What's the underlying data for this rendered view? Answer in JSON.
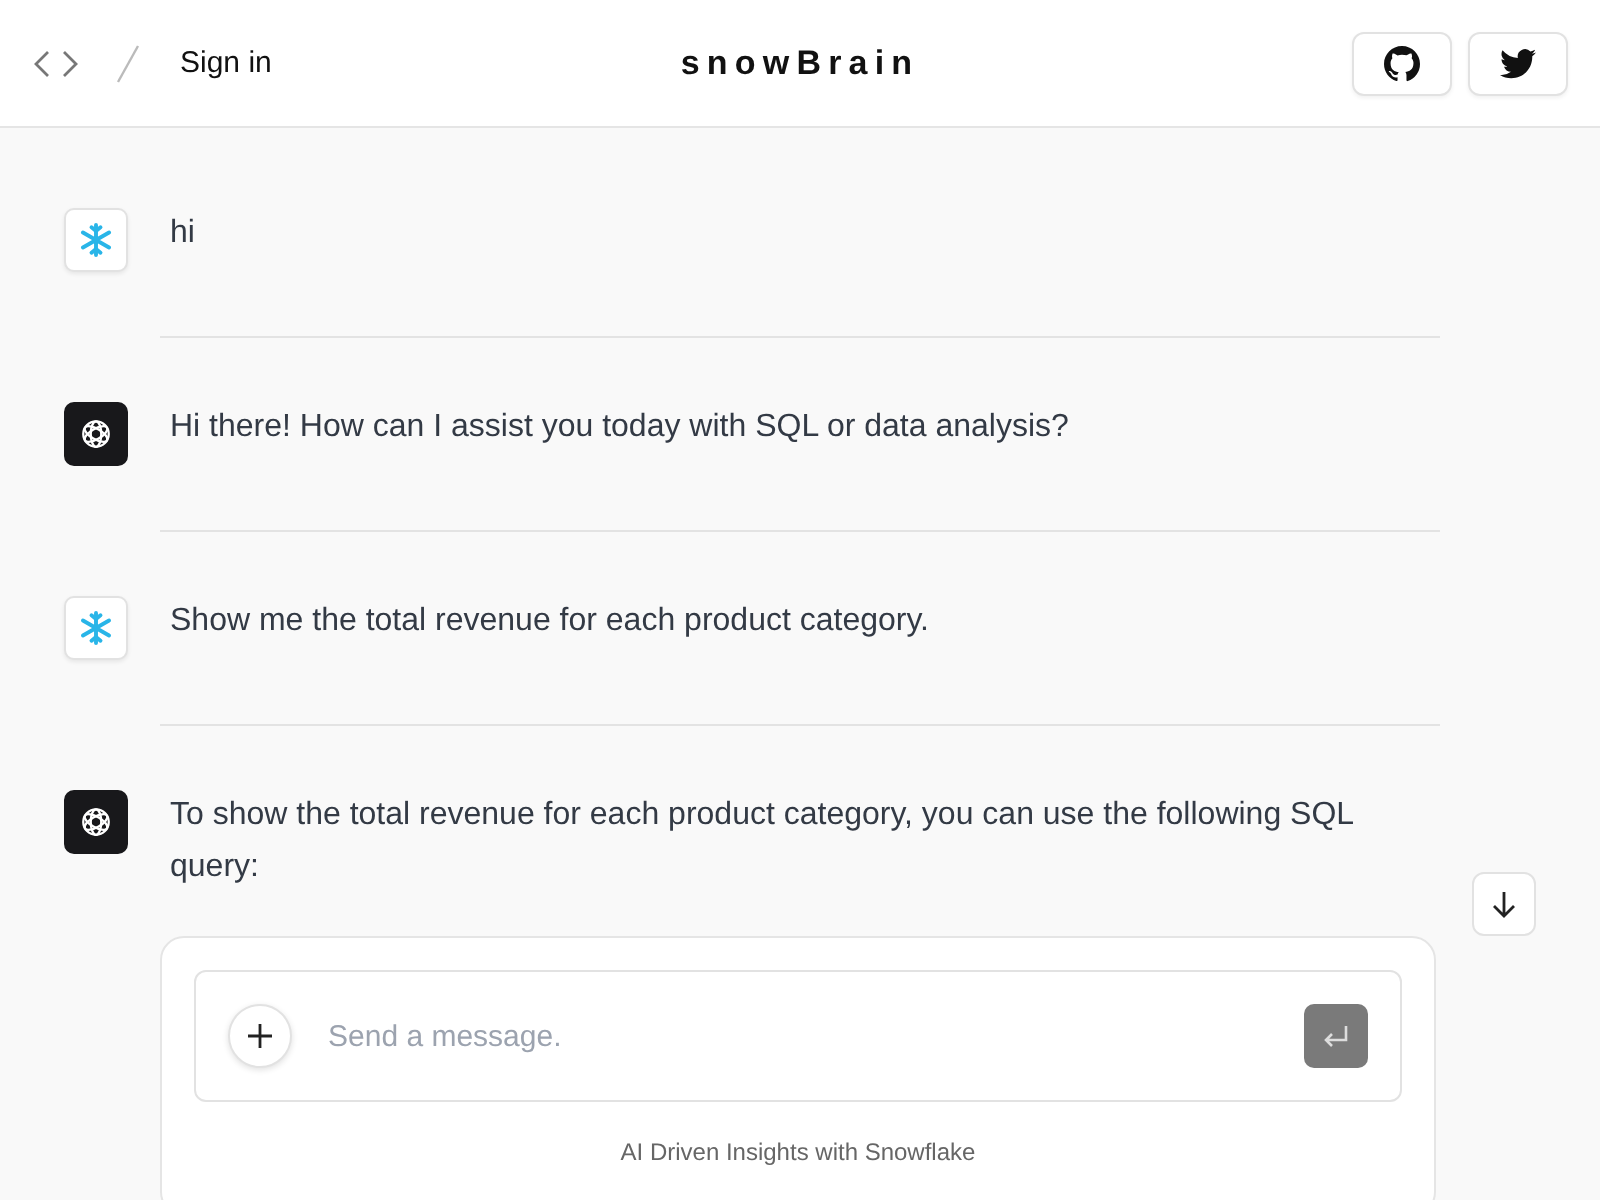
{
  "header": {
    "sign_in": "Sign in",
    "title": "snowBrain"
  },
  "messages": [
    {
      "kind": "user",
      "text": "hi"
    },
    {
      "kind": "assistant",
      "text": "Hi there! How can I assist you today with SQL or data analysis?"
    },
    {
      "kind": "user",
      "text": "Show me the total revenue for each product category."
    },
    {
      "kind": "assistant",
      "text": "To show the total revenue for each product category, you can use the following SQL query:"
    }
  ],
  "composer": {
    "placeholder": "Send a message.",
    "footer": "AI Driven Insights with Snowflake"
  }
}
